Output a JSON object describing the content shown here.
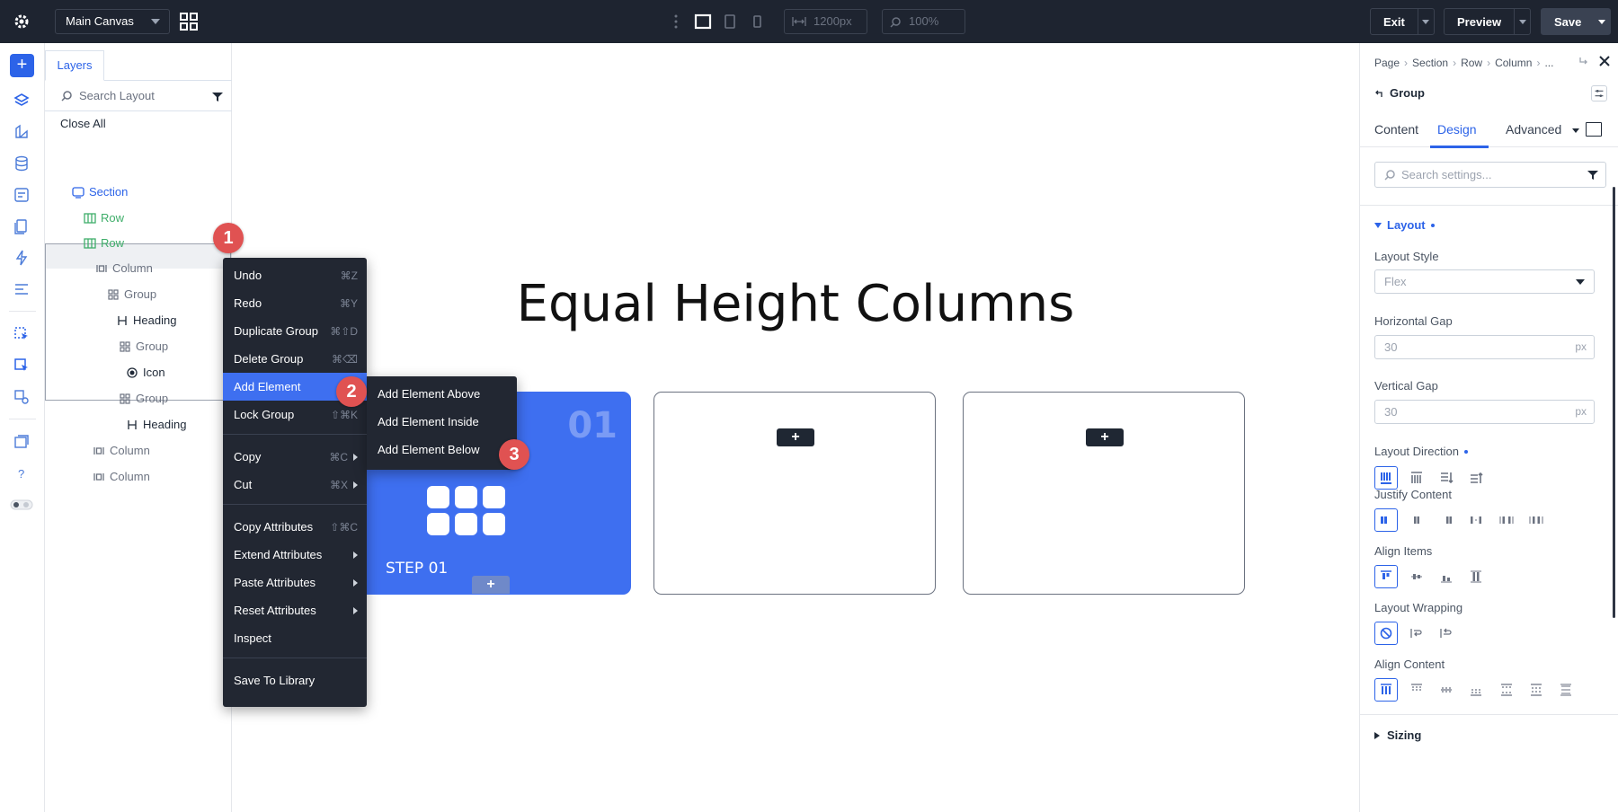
{
  "topbar": {
    "canvas_select": "Main Canvas",
    "width_value": "1200px",
    "zoom_value": "100%",
    "exit_label": "Exit",
    "preview_label": "Preview",
    "save_label": "Save"
  },
  "layers": {
    "tab_label": "Layers",
    "search_placeholder": "Search Layout",
    "close_all": "Close All",
    "items": [
      {
        "label": "Section",
        "icon": "section-icon"
      },
      {
        "label": "Row",
        "icon": "row-icon"
      },
      {
        "label": "Row",
        "icon": "row-icon"
      },
      {
        "label": "Column",
        "icon": "column-icon"
      },
      {
        "label": "Group",
        "icon": "group-icon"
      },
      {
        "label": "Heading",
        "icon": "heading-icon"
      },
      {
        "label": "Group",
        "icon": "group-icon"
      },
      {
        "label": "Icon",
        "icon": "icon-module-icon"
      },
      {
        "label": "Group",
        "icon": "group-icon"
      },
      {
        "label": "Heading",
        "icon": "heading-icon"
      },
      {
        "label": "Column",
        "icon": "column-icon"
      },
      {
        "label": "Column",
        "icon": "column-icon"
      }
    ]
  },
  "badges": [
    "1",
    "2",
    "3"
  ],
  "canvas": {
    "heading": "Equal Height Columns",
    "card_number": "01",
    "card_step": "STEP 01",
    "plus": "+"
  },
  "context_menu": {
    "items": [
      {
        "label": "Undo",
        "shortcut": "⌘Z"
      },
      {
        "label": "Redo",
        "shortcut": "⌘Y"
      },
      {
        "label": "Duplicate Group",
        "shortcut": "⌘⇧D"
      },
      {
        "label": "Delete Group",
        "shortcut": "⌘⌫"
      },
      {
        "label": "Add Element",
        "shortcut": ""
      },
      {
        "label": "Lock Group",
        "shortcut": "⇧⌘K"
      },
      {
        "label": "Copy",
        "shortcut": "⌘C"
      },
      {
        "label": "Cut",
        "shortcut": "⌘X"
      },
      {
        "label": "Copy Attributes",
        "shortcut": "⇧⌘C"
      },
      {
        "label": "Extend Attributes",
        "shortcut": ""
      },
      {
        "label": "Paste Attributes",
        "shortcut": ""
      },
      {
        "label": "Reset Attributes",
        "shortcut": ""
      },
      {
        "label": "Inspect",
        "shortcut": ""
      },
      {
        "label": "Save To Library",
        "shortcut": ""
      }
    ],
    "submenu": [
      "Add Element Above",
      "Add Element Inside",
      "Add Element Below"
    ]
  },
  "right_panel": {
    "breadcrumb": [
      "Page",
      "Section",
      "Row",
      "Column",
      "..."
    ],
    "group_label": "Group",
    "tabs": [
      "Content",
      "Design",
      "Advanced"
    ],
    "active_tab": "Design",
    "search_placeholder": "Search settings...",
    "layout_section": "Layout",
    "layout_style_label": "Layout Style",
    "layout_style_value": "Flex",
    "hgap_label": "Horizontal Gap",
    "hgap_value": "30",
    "vgap_label": "Vertical Gap",
    "vgap_value": "30",
    "unit": "px",
    "direction_label": "Layout Direction",
    "justify_label": "Justify Content",
    "align_items_label": "Align Items",
    "wrapping_label": "Layout Wrapping",
    "align_content_label": "Align Content",
    "sizing_label": "Sizing"
  },
  "colors": {
    "accent": "#2c63e8",
    "topbar": "#1e2430",
    "card": "#3e6ff0",
    "badge": "#e05252"
  }
}
